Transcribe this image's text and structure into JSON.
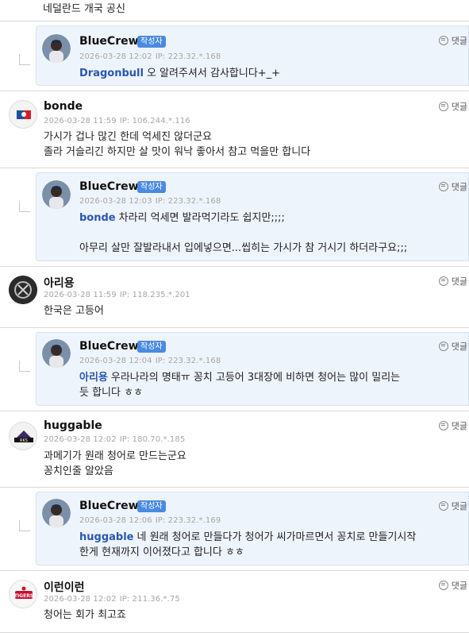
{
  "top_fragment": {
    "text": "네덜란드 개국 공신"
  },
  "reply_label": "댓글",
  "comments": [
    {
      "nick": "BlueCrew",
      "badge": "작성자",
      "date": "2026-03-28 12:02",
      "ip": "IP: 223.32.*.168",
      "mention": "Dragonbull",
      "lines": [
        "오 알려주셔서 감사합니다+_+"
      ]
    },
    {
      "nick": "bonde",
      "date": "2026-03-28 11:59",
      "ip": "IP: 106.244.*.116",
      "lines": [
        "가시가 겁나 많긴 한데 억세진 않더군요",
        "졸라 거슬리긴 하지만 살 맛이 워낙 좋아서 참고 먹을만 합니다"
      ]
    },
    {
      "nick": "BlueCrew",
      "badge": "작성자",
      "date": "2026-03-28 12:03",
      "ip": "IP: 223.32.*.168",
      "mention": "bonde",
      "lines": [
        "차라리 억세면 발라먹기라도 쉽지만;;;;",
        "",
        "아무리 살만 잘발라내서 입에넣으면...씹히는 가시가 참 거시기 하더라구요;;;"
      ]
    },
    {
      "nick": "아리용",
      "date": "2026-03-28 11:59",
      "ip": "IP: 118.235.*.201",
      "lines": [
        "한국은 고등어"
      ]
    },
    {
      "nick": "BlueCrew",
      "badge": "작성자",
      "date": "2026-03-28 12:04",
      "ip": "IP: 223.32.*.168",
      "mention": "아리용",
      "lines": [
        "우라나라의 명태ㅠ 꽁치 고등어 3대장에 비하면 청어는 많이 밀리는",
        "듯 합니다 ㅎㅎ"
      ]
    },
    {
      "nick": "huggable",
      "date": "2026-03-28 12:02",
      "ip": "IP: 180.70.*.185",
      "lines": [
        "과메기가 원래 청어로 만드는군요",
        "꽁치인줄 알았음"
      ]
    },
    {
      "nick": "BlueCrew",
      "badge": "작성자",
      "date": "2026-03-28 12:06",
      "ip": "IP: 223.32.*.169",
      "mention": "huggable",
      "lines": [
        "네 원래 청어로 만들다가 청어가 씨가마르면서 꽁치로 만들기시작",
        "한게 현재까지 이어졌다고 합니다 ㅎㅎ"
      ]
    },
    {
      "nick": "이런이런",
      "date": "2026-03-28 12:02",
      "ip": "IP: 211.36.*.75",
      "lines": [
        "청어는 회가 최고죠"
      ]
    }
  ],
  "colors": {
    "accent": "#4a8ae0",
    "mention": "#2a57b0",
    "reply_bg": "#eef4fb",
    "meta": "#a6a6a6"
  }
}
